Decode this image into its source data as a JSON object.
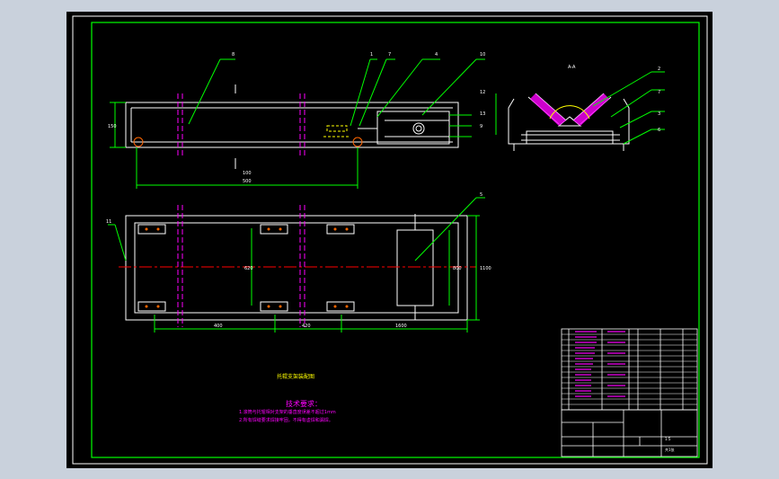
{
  "drawing": {
    "section_label": "A-A",
    "part_callouts": [
      "1",
      "2",
      "3",
      "4",
      "5",
      "6",
      "7",
      "8",
      "9",
      "10",
      "11",
      "12",
      "13"
    ],
    "dimensions": [
      "500",
      "150",
      "400",
      "1600",
      "1100",
      "800",
      "620",
      "420",
      "100"
    ],
    "notes_title": "技术要求：",
    "notes": [
      "1.滚筒与托辊相对支架的垂直度误差不超过1mm",
      "2.所有焊缝要求焊接牢固，不得有虚焊和漏焊。"
    ],
    "assembly_caption": "托辊支架装配图",
    "title_block": {
      "scale": "1:5",
      "sheet": "共1张"
    }
  },
  "colors": {
    "background": "#000000",
    "frame": "#00ff00",
    "outline": "#ffffff",
    "center_line": "#ff0000",
    "section_marks": "#ff00ff",
    "notes_text": "#ff00ff",
    "window_chrome": "#c9d1dc"
  }
}
